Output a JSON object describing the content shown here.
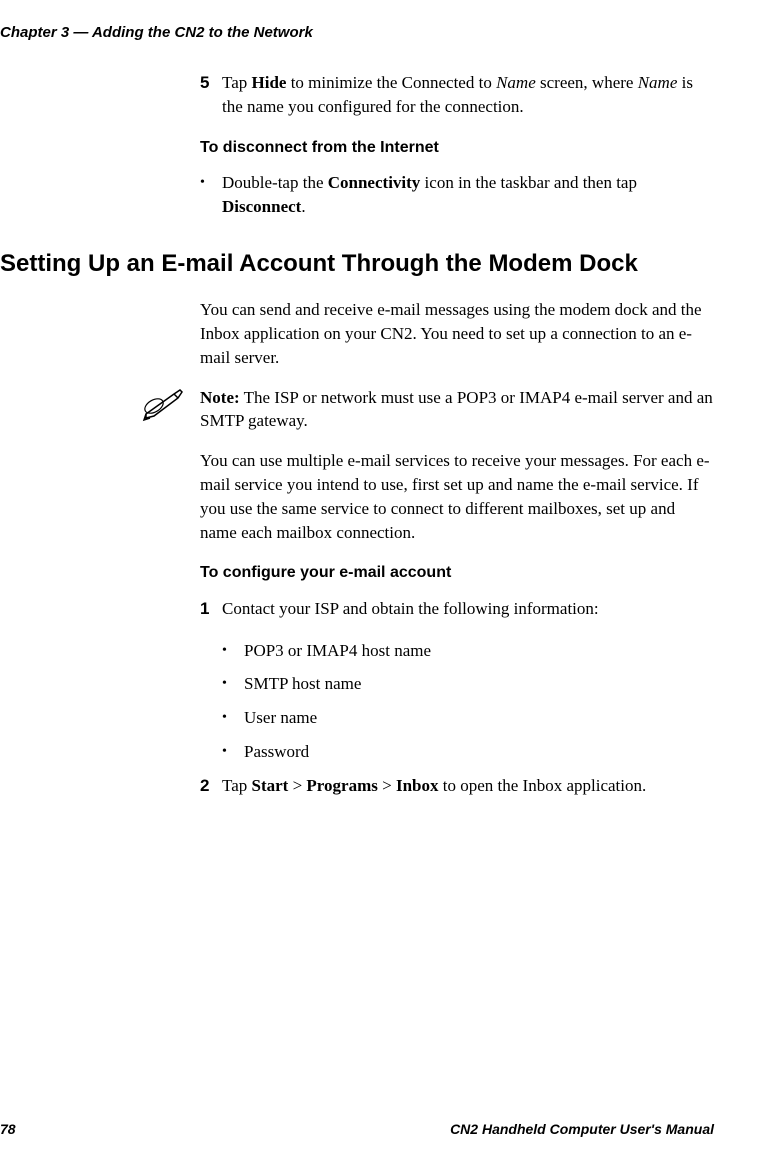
{
  "header": {
    "chapter": "Chapter 3 — Adding the CN2 to the Network"
  },
  "step5": {
    "num": "5",
    "pre": "Tap ",
    "b1": "Hide",
    "mid1": " to minimize the Connected to ",
    "i1": "Name",
    "mid2": " screen, where ",
    "i2": "Name",
    "post": " is the name you configured for the connection."
  },
  "disconnect": {
    "heading": "To disconnect from the Internet",
    "bullet_pre": "Double-tap the ",
    "bullet_b1": "Connectivity",
    "bullet_mid": " icon in the taskbar and then tap ",
    "bullet_b2": "Disconnect",
    "bullet_post": "."
  },
  "section": {
    "heading": "Setting Up an E-mail Account Through the Modem Dock",
    "intro": "You can send and receive e-mail messages using the modem dock and the Inbox application on your CN2. You need to set up a connection to an e-mail server.",
    "note_b": "Note:",
    "note_text": " The ISP or network must use a POP3 or IMAP4 e-mail server and an SMTP gateway.",
    "para2": "You can use multiple e-mail services to receive your messages. For each e-mail service you intend to use, first set up and name the e-mail service. If you use the same service to connect to different mailboxes, set up and name each mailbox connection."
  },
  "configure": {
    "heading": "To configure your e-mail account",
    "step1": {
      "num": "1",
      "text": "Contact your ISP and obtain the following information:",
      "items": [
        "POP3 or IMAP4 host name",
        "SMTP host name",
        "User name",
        "Password"
      ]
    },
    "step2": {
      "num": "2",
      "pre": "Tap ",
      "b1": "Start",
      "s1": " > ",
      "b2": "Programs",
      "s2": " > ",
      "b3": "Inbox",
      "post": " to open the Inbox application."
    }
  },
  "footer": {
    "page": "78",
    "title": "CN2 Handheld Computer User's Manual"
  }
}
